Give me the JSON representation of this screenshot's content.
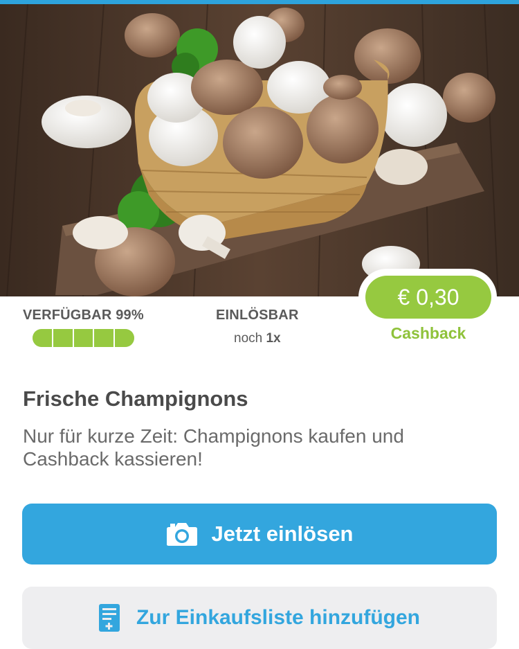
{
  "hero": {
    "image_subject": "mushrooms-in-wicker-basket"
  },
  "offer": {
    "availability_label": "VERFÜGBAR 99%",
    "availability_fraction": 0.99,
    "redeem_label": "EINLÖSBAR",
    "redeem_prefix": "noch",
    "redeem_count": "1x",
    "cashback_value": "€ 0,30",
    "cashback_label": "Cashback",
    "title": "Frische Champignons",
    "description": "Nur für kurze Zeit: Champignons kaufen und Cashback kassieren!"
  },
  "actions": {
    "redeem_button_label": "Jetzt einlösen",
    "redeem_button_icon": "camera-icon",
    "shopping_list_button_label": "Zur Einkaufsliste hinzufügen",
    "shopping_list_button_icon": "shopping-list-add-icon"
  },
  "colors": {
    "accent_blue": "#33a6de",
    "accent_green": "#96c940"
  }
}
